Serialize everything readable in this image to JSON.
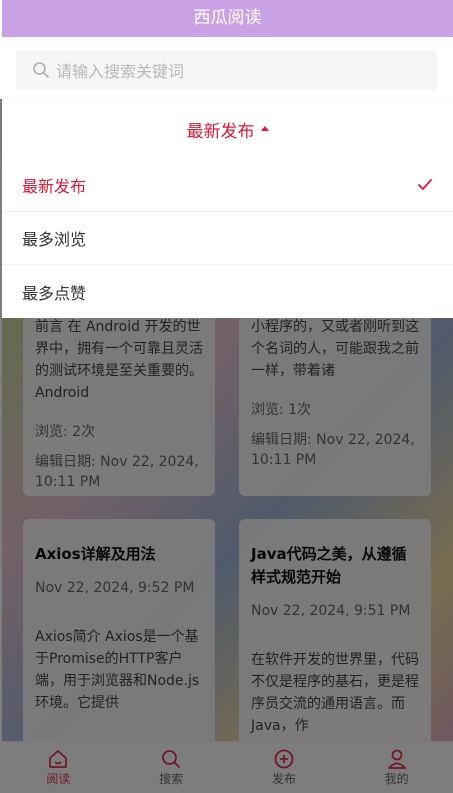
{
  "header": {
    "title": "西瓜阅读"
  },
  "search": {
    "placeholder": "请输入搜索关键词"
  },
  "sort": {
    "current": "最新发布",
    "options": [
      {
        "label": "最新发布",
        "selected": true
      },
      {
        "label": "最多浏览",
        "selected": false
      },
      {
        "label": "最多点赞",
        "selected": false
      }
    ]
  },
  "cards": [
    {
      "text": "前言 在 Android 开发的世界中，拥有一个可靠且灵活的测试环境是至关重要的。Android",
      "views": "浏览: 2次",
      "edit_date": "编辑日期: Nov 22, 2024, 10:11 PM"
    },
    {
      "text": "小程序的，又或者刚听到这个名词的人，可能跟我之前一样，带着诸",
      "views": "浏览: 1次",
      "edit_date": "编辑日期: Nov 22, 2024, 10:11 PM"
    },
    {
      "title": "Axios详解及用法",
      "date": "Nov 22, 2024, 9:52 PM",
      "text": "Axios简介 Axios是一个基于Promise的HTTP客户端，用于浏览器和Node.js环境。它提供"
    },
    {
      "title": "Java代码之美，从遵循样式规范开始",
      "date": "Nov 22, 2024, 9:51 PM",
      "text": "在软件开发的世界里，代码不仅是程序的基石，更是程序员交流的通用语言。而Java，作"
    }
  ],
  "nav": [
    {
      "label": "阅读",
      "icon": "home-icon",
      "active": true
    },
    {
      "label": "搜索",
      "icon": "search-icon",
      "active": false
    },
    {
      "label": "发布",
      "icon": "plus-circle-icon",
      "active": false
    },
    {
      "label": "我的",
      "icon": "user-icon",
      "active": false
    }
  ],
  "colors": {
    "header_bg": "#cba1e6",
    "accent": "#e0183a",
    "overlay": "rgba(0,0,0,0.5)"
  }
}
